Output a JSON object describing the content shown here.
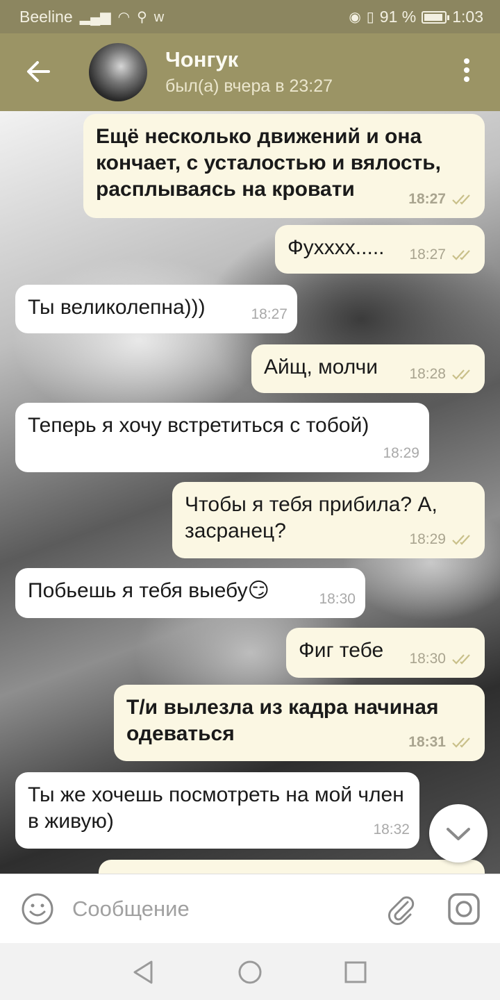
{
  "status_bar": {
    "carrier": "Beeline",
    "battery_percent_text": "91 %",
    "battery_level": 0.91,
    "time": "1:03"
  },
  "header": {
    "contact_name": "Чонгук",
    "contact_status": "был(а) вчера в 23:27",
    "icons": [
      "back-arrow-icon",
      "avatar",
      "more-vertical-icon"
    ]
  },
  "messages": [
    {
      "dir": "out",
      "bold": true,
      "text": "Ещё несколько движений и она кончает, с усталостью и вялость, расплываясь на кровати",
      "time": "18:27",
      "read": true
    },
    {
      "dir": "out",
      "bold": false,
      "text": "Фухххх.....",
      "time": "18:27",
      "read": true
    },
    {
      "dir": "in",
      "bold": false,
      "text": "Ты великолепна)))",
      "time": "18:27"
    },
    {
      "dir": "out",
      "bold": false,
      "text": "Айщ, молчи",
      "time": "18:28",
      "read": true
    },
    {
      "dir": "in",
      "bold": false,
      "text": "Теперь я хочу встретиться с тобой)",
      "time": "18:29"
    },
    {
      "dir": "out",
      "bold": false,
      "text": "Чтобы я тебя прибила? А, засранец?",
      "time": "18:29",
      "read": true
    },
    {
      "dir": "in",
      "bold": false,
      "text": "Побьешь я тебя выебу😏",
      "time": "18:30"
    },
    {
      "dir": "out",
      "bold": false,
      "text": "Фиг тебе",
      "time": "18:30",
      "read": true
    },
    {
      "dir": "out",
      "bold": true,
      "text": "Т/и вылезла из кадра начиная одеваться",
      "time": "18:31",
      "read": true
    },
    {
      "dir": "in",
      "bold": false,
      "text": "Ты же хочешь посмотреть на мой член в живую)",
      "time": "18:32"
    }
  ],
  "input": {
    "placeholder": "Сообщение",
    "value": ""
  },
  "colors": {
    "header": "#9b9465",
    "status_bar": "#8c8660",
    "outgoing_bubble": "#fbf7e3",
    "incoming_bubble": "#ffffff",
    "read_ticks": "#c9c08a"
  }
}
